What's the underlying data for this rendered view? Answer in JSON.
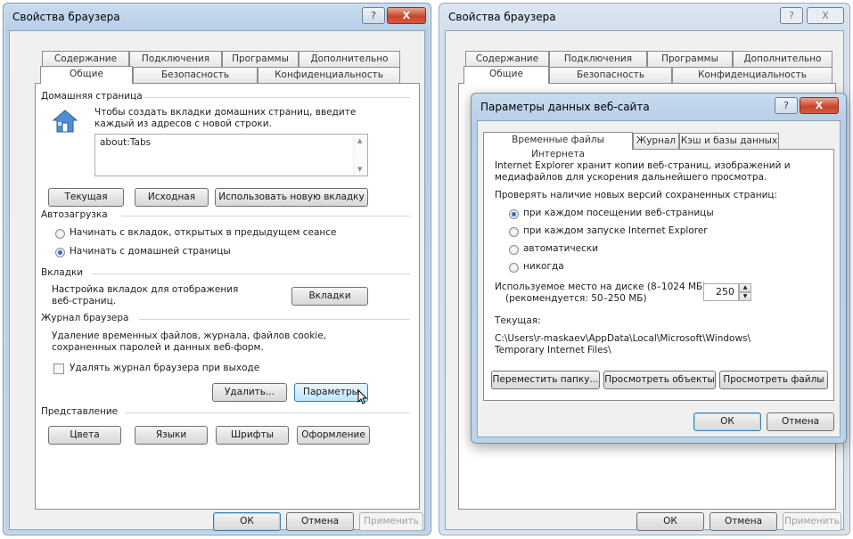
{
  "left_window": {
    "title": "Свойства браузера",
    "help_glyph": "?",
    "close_glyph": "X",
    "tabs_row1": [
      "Содержание",
      "Подключения",
      "Программы",
      "Дополнительно"
    ],
    "tabs_row2": [
      "Общие",
      "Безопасность",
      "Конфиденциальность"
    ],
    "home": {
      "legend": "Домашняя страница",
      "hint_line1": "Чтобы создать вкладки домашних страниц, введите",
      "hint_line2": "каждый из адресов с новой строки.",
      "value": "about:Tabs",
      "btn_current": "Текущая",
      "btn_default": "Исходная",
      "btn_newtab": "Использовать новую вкладку"
    },
    "startup": {
      "legend": "Автозагрузка",
      "opt1": "Начинать с вкладок, открытых в предыдущем сеансе",
      "opt2": "Начинать с домашней страницы",
      "selected": 2
    },
    "tabs_section": {
      "legend": "Вкладки",
      "text_line1": "Настройка вкладок для отображения",
      "text_line2": "веб-страниц.",
      "button": "Вкладки"
    },
    "history": {
      "legend": "Журнал браузера",
      "text_line1": "Удаление временных файлов, журнала, файлов cookie,",
      "text_line2": "сохраненных паролей и данных веб-форм.",
      "checkbox": "Удалять журнал браузера при выходе",
      "checked": false,
      "btn_delete": "Удалить...",
      "btn_settings": "Параметры"
    },
    "appearance": {
      "legend": "Представление",
      "btn_colors": "Цвета",
      "btn_languages": "Языки",
      "btn_fonts": "Шрифты",
      "btn_accessibility": "Оформление"
    },
    "footer": {
      "ok": "ОК",
      "cancel": "Отмена",
      "apply": "Применить"
    }
  },
  "right_window": {
    "title": "Свойства браузера",
    "help_glyph": "?",
    "close_glyph": "X",
    "tabs_row1": [
      "Содержание",
      "Подключения",
      "Программы",
      "Дополнительно"
    ],
    "tabs_row2": [
      "Общие",
      "Безопасность",
      "Конфиденциальность"
    ],
    "footer": {
      "ok": "ОК",
      "cancel": "Отмена",
      "apply": "Применить"
    }
  },
  "dialog": {
    "title": "Параметры данных веб-сайта",
    "help_glyph": "?",
    "close_glyph": "X",
    "tabs": [
      "Временные файлы Интернета",
      "Журнал",
      "Кэш и базы данных"
    ],
    "intro_line1": "Internet Explorer хранит копии веб-страниц, изображений и",
    "intro_line2": "медиафайлов для ускорения дальнейшего просмотра.",
    "check_label": "Проверять наличие новых версий сохраненных страниц:",
    "options": [
      "при каждом посещении веб-страницы",
      "при каждом запуске Internet Explorer",
      "автоматически",
      "никогда"
    ],
    "selected_option": 1,
    "disk_label_line1": "Используемое место на диске (8–1024 МБ)",
    "disk_label_line2": "(рекомендуется: 50–250 МБ)",
    "disk_value": "250",
    "current_label": "Текущая:",
    "path_line1": "C:\\Users\\r-maskaev\\AppData\\Local\\Microsoft\\Windows\\",
    "path_line2": "Temporary Internet Files\\",
    "btn_move": "Переместить папку...",
    "btn_view_objects": "Просмотреть объекты",
    "btn_view_files": "Просмотреть файлы",
    "ok": "ОК",
    "cancel": "Отмена"
  }
}
